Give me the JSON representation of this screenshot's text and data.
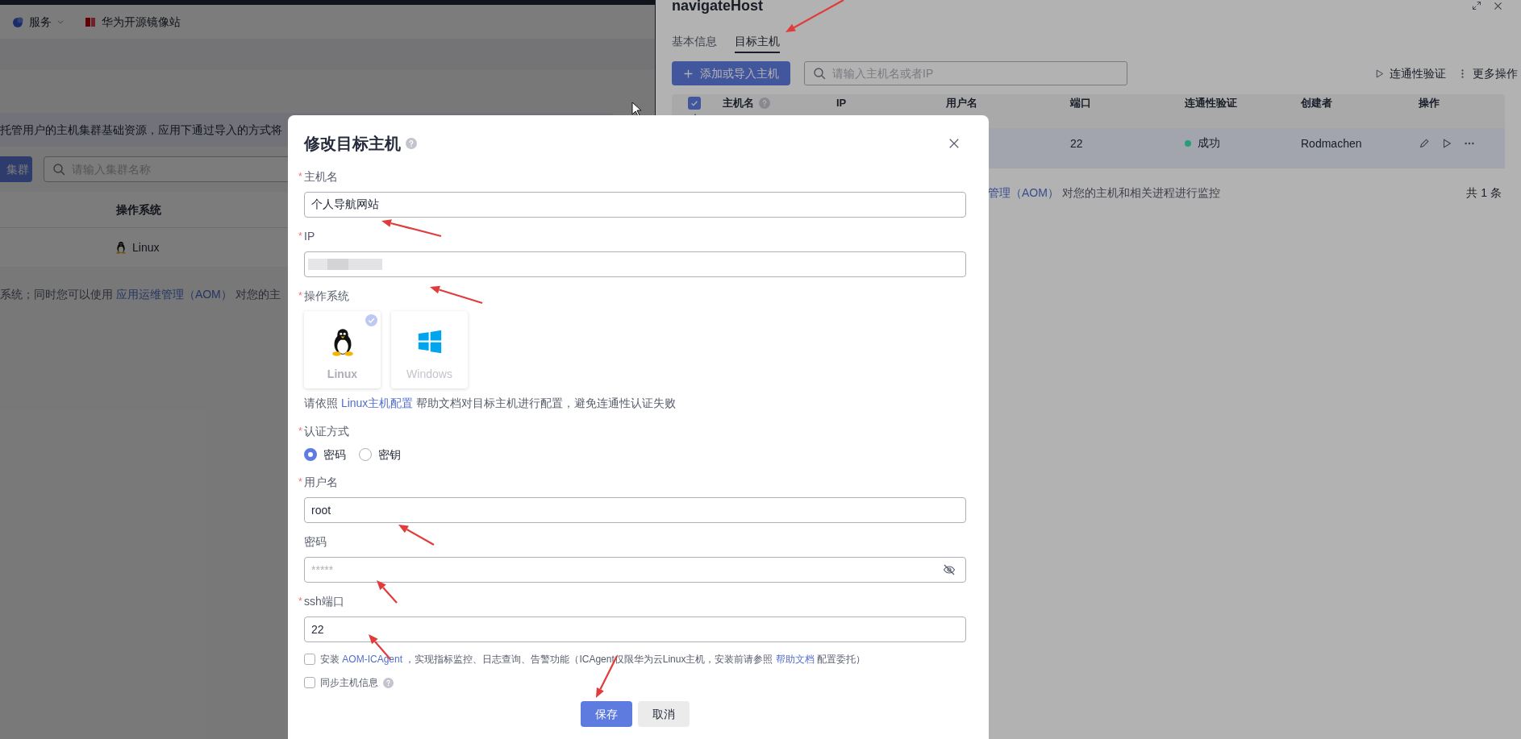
{
  "background_page": {
    "nav": [
      {
        "kind": "dropdown",
        "label": "服务"
      },
      {
        "kind": "link",
        "label": "华为开源镜像站"
      }
    ],
    "banner": "托管用户的主机集群基础资源，应用下通过导入的方式将",
    "create_button": "集群",
    "search": {
      "placeholder": "请输入集群名称"
    },
    "table": {
      "columns": [
        "操作系统"
      ],
      "rows": [
        [
          "Linux"
        ]
      ]
    },
    "footer": [
      {
        "text": "系统；同时您可以使用 "
      },
      {
        "text": "应用运维管理（AOM）",
        "link": true
      },
      {
        "text": " 对您的主"
      }
    ]
  },
  "drawer": {
    "title": "navigateHost",
    "tabs": [
      {
        "label": "基本信息",
        "selected": false
      },
      {
        "label": "目标主机",
        "selected": true
      }
    ],
    "add_button": "添加或导入主机",
    "search": {
      "placeholder": "请输入主机名或者IP"
    },
    "actions": [
      {
        "kind": "play",
        "label": "连通性验证"
      },
      {
        "kind": "more",
        "label": "更多操作"
      }
    ],
    "table": {
      "select_all_checked": true,
      "columns": [
        {
          "label": "主机名",
          "help": true
        },
        {
          "label": "IP",
          "help": false
        },
        {
          "label": "用户名",
          "help": false
        },
        {
          "label": "端口",
          "help": false
        },
        {
          "label": "连通性验证",
          "help": false
        },
        {
          "label": "创建者",
          "help": false
        },
        {
          "label": "操作",
          "help": false
        }
      ],
      "rows": [
        {
          "selected": true,
          "port": "22",
          "status": {
            "label": "成功",
            "color": "#2a9d78"
          },
          "creator": "Rodmachen"
        }
      ]
    },
    "footer": [
      {
        "text": "管理（AOM）",
        "link": true
      },
      {
        "text": " 对您的主机和相关进程进行监控"
      }
    ],
    "total": "共 1 条"
  },
  "dialog": {
    "title": "修改目标主机",
    "fields": [
      {
        "kind": "text",
        "label": "主机名",
        "required_mark": "*",
        "value": "个人导航网站"
      },
      {
        "kind": "redacted",
        "label": "IP",
        "required_mark": "*"
      },
      {
        "kind": "os",
        "label": "操作系统",
        "required_mark": "*",
        "options": [
          {
            "kind": "linux",
            "label": "Linux",
            "selected": true
          },
          {
            "kind": "windows",
            "label": "Windows",
            "selected": false
          }
        ],
        "help": [
          {
            "text": "请依照 "
          },
          {
            "text": "Linux主机配置",
            "link": true
          },
          {
            "text": " 帮助文档对目标主机进行配置，避免连通性认证失败"
          }
        ]
      },
      {
        "kind": "radio",
        "label": "认证方式",
        "required_mark": "*",
        "options": [
          {
            "label": "密码",
            "selected": true
          },
          {
            "label": "密钥",
            "selected": false
          }
        ]
      },
      {
        "kind": "text",
        "label": "用户名",
        "required_mark": "*",
        "value": "root"
      },
      {
        "kind": "password",
        "label": "密码",
        "placeholder": "*****"
      },
      {
        "kind": "text",
        "label": "ssh端口",
        "required_mark": "*",
        "value": "22"
      }
    ],
    "checkboxes": [
      {
        "checked": false,
        "help": false,
        "parts": [
          {
            "text": "安装 "
          },
          {
            "text": "AOM-ICAgent",
            "link": true
          },
          {
            "text": " ，实现指标监控、日志查询、告警功能（ICAgent仅限华为云Linux主机，安装前请参照 "
          },
          {
            "text": "帮助文档",
            "link": true
          },
          {
            "text": " 配置委托）"
          }
        ]
      },
      {
        "checked": false,
        "help": true,
        "parts": [
          {
            "text": "同步主机信息"
          }
        ]
      }
    ],
    "buttons": [
      {
        "kind": "primary",
        "label": "保存"
      },
      {
        "kind": "secondary",
        "label": "取消"
      }
    ]
  }
}
